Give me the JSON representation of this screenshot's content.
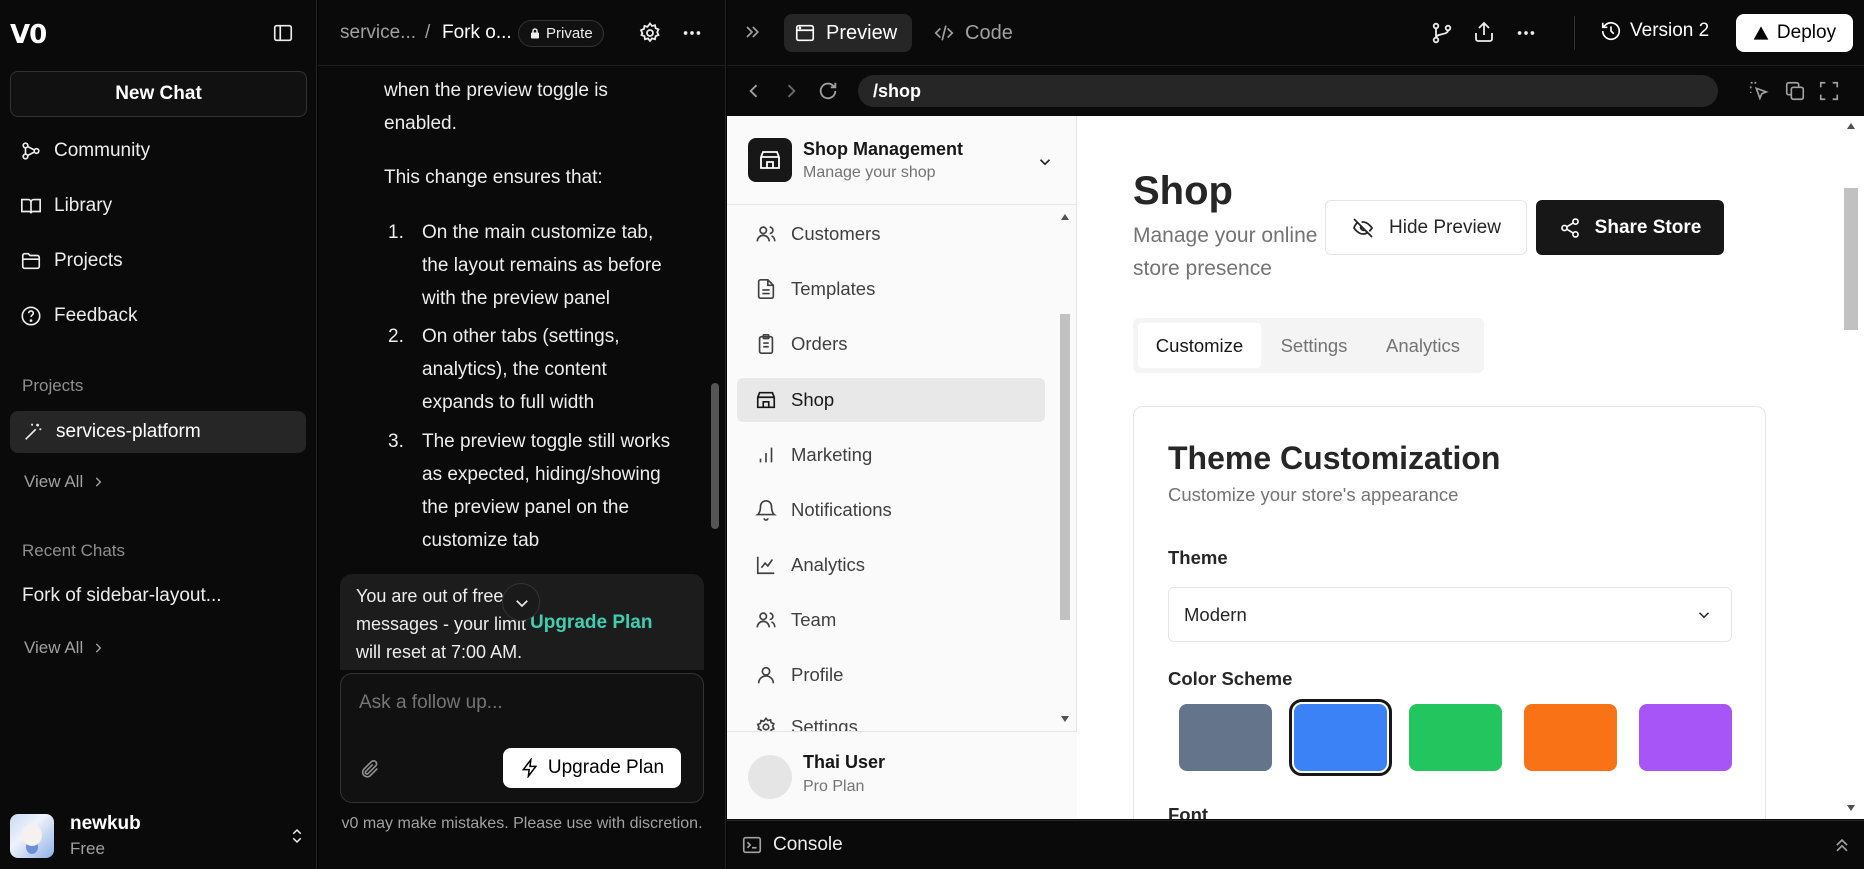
{
  "sidebar": {
    "logo": "V0",
    "new_chat": "New Chat",
    "nav": [
      {
        "label": "Community",
        "icon": "community-icon"
      },
      {
        "label": "Library",
        "icon": "book-icon"
      },
      {
        "label": "Projects",
        "icon": "folder-icon"
      },
      {
        "label": "Feedback",
        "icon": "help-circle-icon"
      }
    ],
    "projects_label": "Projects",
    "project_item": "services-platform",
    "view_all": "View All",
    "recent_label": "Recent Chats",
    "recent_item": "Fork of sidebar-layout...",
    "view_all_2": "View All",
    "user": {
      "name": "newkub",
      "plan": "Free"
    }
  },
  "chat": {
    "crumb_project": "service...",
    "crumb_sep": "/",
    "crumb_chat": "Fork o...",
    "privacy": "Private",
    "message_lines": {
      "intro_1": "when the preview toggle is",
      "intro_2": "enabled.",
      "ensures": "This change ensures that:",
      "items": [
        {
          "num": "1.",
          "lines": [
            "On the main customize tab,",
            "the layout remains as before",
            "with the preview panel"
          ]
        },
        {
          "num": "2.",
          "lines": [
            "On other tabs (settings,",
            "analytics), the content",
            "expands to full width"
          ]
        },
        {
          "num": "3.",
          "lines": [
            "The preview toggle still works",
            "as expected, hiding/showing",
            "the preview panel on the",
            "customize tab"
          ]
        }
      ]
    },
    "limit_lines": [
      "You are out of free",
      "messages - your limit",
      "will reset at 7:00 AM."
    ],
    "upgrade_link": "Upgrade Plan",
    "input_placeholder": "Ask a follow up...",
    "upgrade_button": "Upgrade Plan",
    "disclaimer": "v0 may make mistakes. Please use with discretion."
  },
  "topbar": {
    "preview_tab": "Preview",
    "code_tab": "Code",
    "version": "Version 2",
    "deploy": "Deploy",
    "url": "/shop",
    "console": "Console"
  },
  "preview_app": {
    "header": {
      "title": "Shop Management",
      "subtitle": "Manage your shop"
    },
    "menu": [
      {
        "label": "Customers",
        "icon": "users-icon",
        "active": false
      },
      {
        "label": "Templates",
        "icon": "file-text-icon",
        "active": false
      },
      {
        "label": "Orders",
        "icon": "clipboard-icon",
        "active": false
      },
      {
        "label": "Shop",
        "icon": "store-icon",
        "active": true
      },
      {
        "label": "Marketing",
        "icon": "bar-chart-icon",
        "active": false
      },
      {
        "label": "Notifications",
        "icon": "bell-icon",
        "active": false
      },
      {
        "label": "Analytics",
        "icon": "line-chart-icon",
        "active": false
      },
      {
        "label": "Team",
        "icon": "users-icon",
        "active": false
      },
      {
        "label": "Profile",
        "icon": "user-icon",
        "active": false
      },
      {
        "label": "Settings",
        "icon": "gear-icon",
        "active": false
      }
    ],
    "footer_user": {
      "name": "Thai User",
      "plan": "Pro Plan"
    },
    "page": {
      "title": "Shop",
      "subtitle": "Manage your online store presence",
      "hide_preview": "Hide Preview",
      "share_store": "Share Store",
      "tabs": [
        "Customize",
        "Settings",
        "Analytics"
      ],
      "active_tab": "Customize",
      "card_title": "Theme Customization",
      "card_subtitle": "Customize your store's appearance",
      "theme_label": "Theme",
      "theme_value": "Modern",
      "color_label": "Color Scheme",
      "colors": [
        "#64748b",
        "#3b82f6",
        "#22c55e",
        "#f97316",
        "#a855f7"
      ],
      "selected_color": "#3b82f6",
      "font_label": "Font"
    }
  }
}
